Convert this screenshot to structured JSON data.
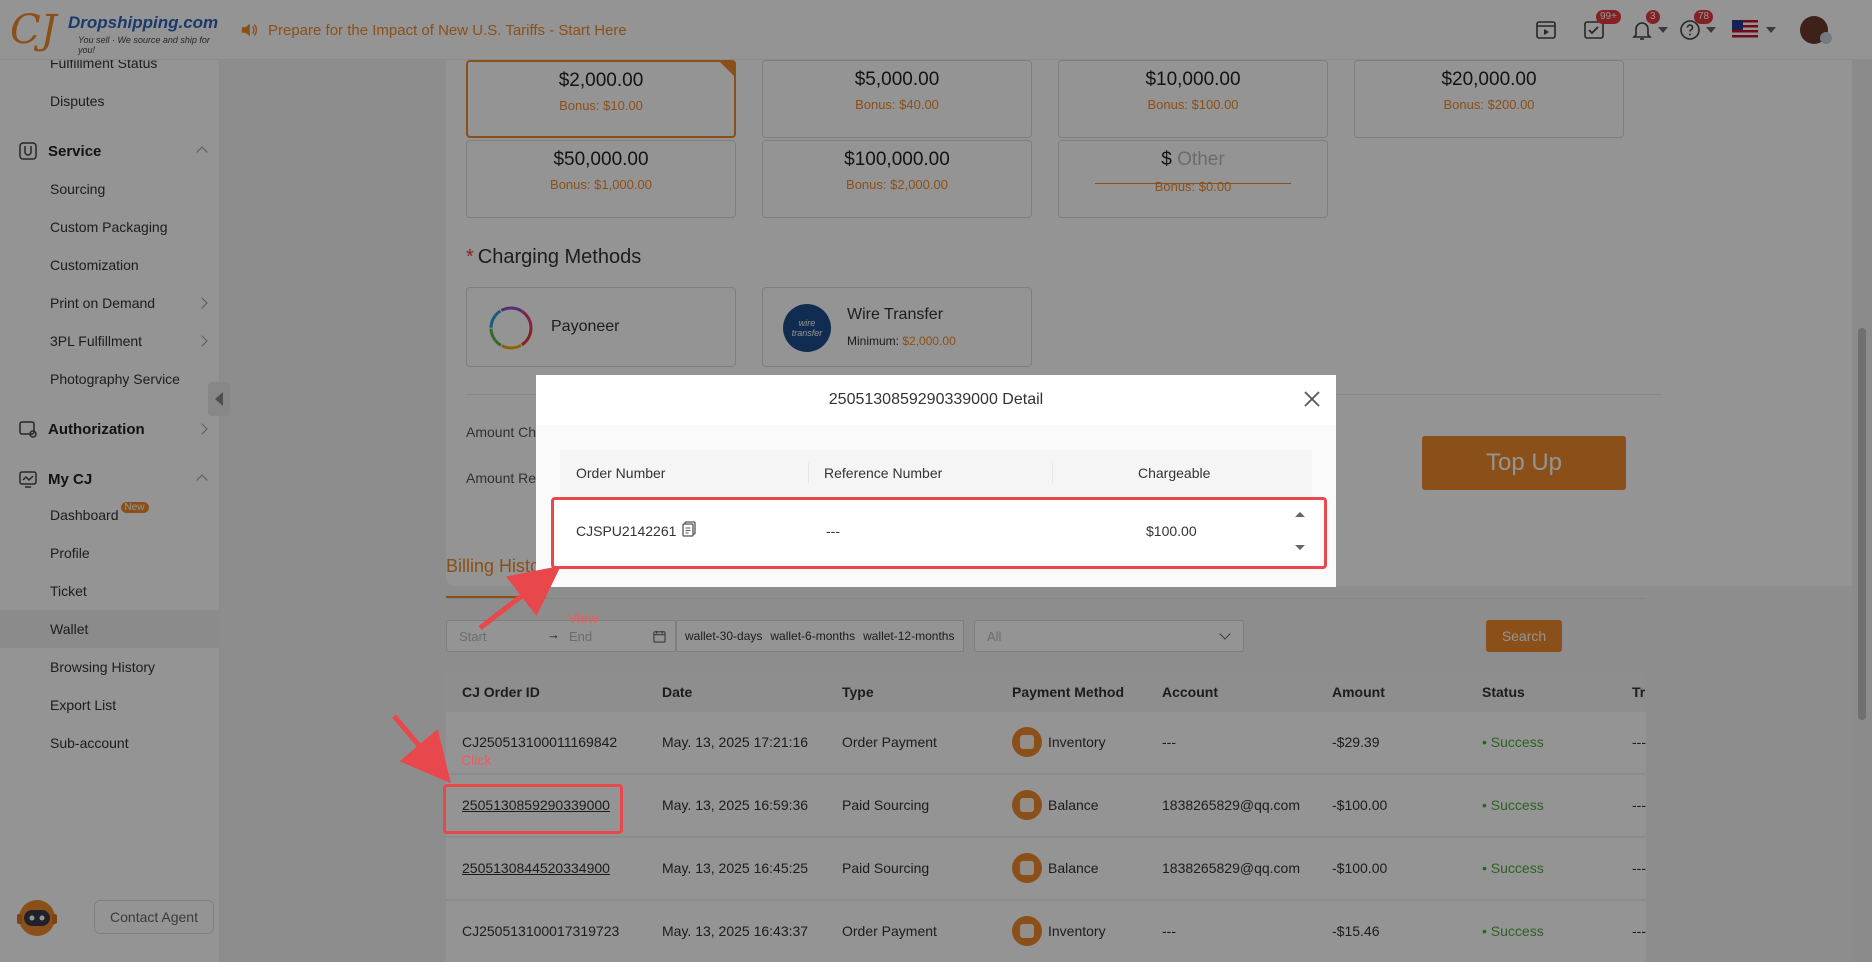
{
  "header": {
    "logo_cj": "CJ",
    "logo_brand": "Dropshipping.com",
    "logo_tagline": "You sell · We source and ship for you!",
    "announcement": "Prepare for the Impact of New U.S. Tariffs - Start Here",
    "todo_badge": "99+",
    "notifications_badge": "3",
    "help_badge": "78"
  },
  "sidebar": {
    "items_top": [
      {
        "label": "Fulfillment Status"
      },
      {
        "label": "Disputes"
      }
    ],
    "service": {
      "label": "Service",
      "items": [
        {
          "label": "Sourcing"
        },
        {
          "label": "Custom Packaging"
        },
        {
          "label": "Customization"
        },
        {
          "label": "Print on Demand"
        },
        {
          "label": "3PL Fulfillment"
        },
        {
          "label": "Photography Service"
        }
      ]
    },
    "authorization": {
      "label": "Authorization"
    },
    "mycj": {
      "label": "My CJ",
      "items": [
        {
          "label": "Dashboard",
          "badge": "New"
        },
        {
          "label": "Profile"
        },
        {
          "label": "Ticket"
        },
        {
          "label": "Wallet"
        },
        {
          "label": "Browsing History"
        },
        {
          "label": "Export List"
        },
        {
          "label": "Sub-account"
        }
      ]
    },
    "contact_agent": "Contact Agent"
  },
  "recharge": {
    "amounts": [
      {
        "value": "$2,000.00",
        "bonus": "Bonus: $10.00"
      },
      {
        "value": "$5,000.00",
        "bonus": "Bonus: $40.00"
      },
      {
        "value": "$10,000.00",
        "bonus": "Bonus: $100.00"
      },
      {
        "value": "$20,000.00",
        "bonus": "Bonus: $200.00"
      },
      {
        "value": "$50,000.00",
        "bonus": "Bonus: $1,000.00"
      },
      {
        "value": "$100,000.00",
        "bonus": "Bonus: $2,000.00"
      }
    ],
    "other": {
      "prefix": "$",
      "placeholder": "Other",
      "bonus": "Bonus: $0.00"
    },
    "charging_methods_label": "Charging Methods",
    "required_star": "*",
    "methods": [
      {
        "name": "Payoneer"
      },
      {
        "name": "Wire Transfer",
        "minimum_label": "Minimum:",
        "minimum_value": "$2,000.00",
        "logo_text": "wire transfer"
      }
    ],
    "amount_charged_label": "Amount Ch",
    "amount_received_label": "Amount Re",
    "top_up": "Top Up"
  },
  "billing": {
    "tab_label": "Billing Histo",
    "filter": {
      "start_placeholder": "Start",
      "end_placeholder": "End",
      "arrow": "→",
      "quick_ranges": [
        "wallet-30-days",
        "wallet-6-months",
        "wallet-12-months"
      ],
      "type_placeholder": "All",
      "search": "Search"
    },
    "columns": [
      "CJ Order ID",
      "Date",
      "Type",
      "Payment Method",
      "Account",
      "Amount",
      "Status",
      "Tr"
    ],
    "rows": [
      {
        "order_id": "CJ250513100011169842",
        "date": "May. 13, 2025 17:21:16",
        "type": "Order Payment",
        "method": "Inventory",
        "account": "---",
        "amount": "-$29.39",
        "status": "Success",
        "tr": "---"
      },
      {
        "order_id": "2505130859290339000",
        "date": "May. 13, 2025 16:59:36",
        "type": "Paid Sourcing",
        "method": "Balance",
        "account": "1838265829@qq.com",
        "amount": "-$100.00",
        "status": "Success",
        "tr": "---"
      },
      {
        "order_id": "2505130844520334900",
        "date": "May. 13, 2025 16:45:25",
        "type": "Paid Sourcing",
        "method": "Balance",
        "account": "1838265829@qq.com",
        "amount": "-$100.00",
        "status": "Success",
        "tr": "---"
      },
      {
        "order_id": "CJ250513100017319723",
        "date": "May. 13, 2025 16:43:37",
        "type": "Order Payment",
        "method": "Inventory",
        "account": "---",
        "amount": "-$15.46",
        "status": "Success",
        "tr": "---"
      }
    ]
  },
  "modal": {
    "title": "2505130859290339000 Detail",
    "columns": [
      "Order Number",
      "Reference Number",
      "Chargeable"
    ],
    "row": {
      "order_number": "CJSPU2142261",
      "reference": "---",
      "chargeable": "$100.00"
    }
  },
  "annotations": {
    "view": "View",
    "click": "Click",
    "color": "#e8484b"
  },
  "colors": {
    "accent": "#f08a2b",
    "success": "#52a640",
    "brand_blue": "#2f63b8"
  }
}
